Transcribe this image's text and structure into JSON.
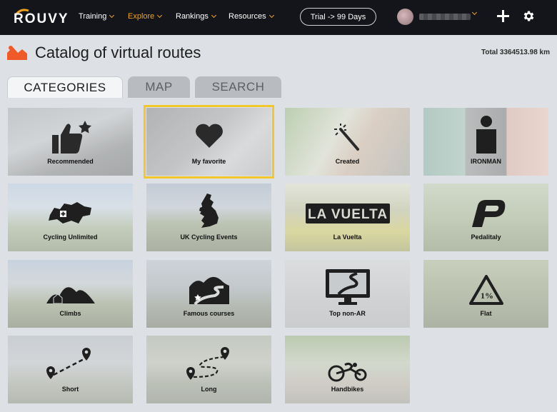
{
  "nav": {
    "logo": "ROUVY",
    "items": [
      {
        "label": "Training",
        "active": false
      },
      {
        "label": "Explore",
        "active": true
      },
      {
        "label": "Rankings",
        "active": false
      },
      {
        "label": "Resources",
        "active": false
      }
    ],
    "trial_label": "Trial -> 99 Days"
  },
  "header": {
    "title": "Catalog of virtual routes",
    "total": "Total 3364513.98 km"
  },
  "tabs": [
    "CATEGORIES",
    "MAP",
    "SEARCH"
  ],
  "categories": [
    {
      "label": "Recommended",
      "icon": "thumbs-up-star-icon"
    },
    {
      "label": "My favorite",
      "icon": "heart-icon",
      "selected": true
    },
    {
      "label": "Created",
      "icon": "magic-wand-icon"
    },
    {
      "label": "IRONMAN",
      "icon": "ironman-logo-icon"
    },
    {
      "label": "Cycling Unlimited",
      "icon": "switzerland-map-icon"
    },
    {
      "label": "UK Cycling Events",
      "icon": "uk-map-icon"
    },
    {
      "label": "La Vuelta",
      "icon": "la-vuelta-logo-icon"
    },
    {
      "label": "Pedalitaly",
      "icon": "pedalitaly-logo-icon"
    },
    {
      "label": "Climbs",
      "icon": "mountains-icon"
    },
    {
      "label": "Famous courses",
      "icon": "road-star-icon"
    },
    {
      "label": "Top non-AR",
      "icon": "monitor-road-icon"
    },
    {
      "label": "Flat",
      "icon": "grade-sign-icon"
    },
    {
      "label": "Short",
      "icon": "short-route-icon"
    },
    {
      "label": "Long",
      "icon": "long-route-icon"
    },
    {
      "label": "Handbikes",
      "icon": "handbike-icon"
    }
  ],
  "colors": {
    "accent": "#f0a41c",
    "selected_outline": "#f2c72b",
    "nav_bg": "#14151a",
    "page_bg": "#dde0e4",
    "title_icon": "#f05a28"
  }
}
